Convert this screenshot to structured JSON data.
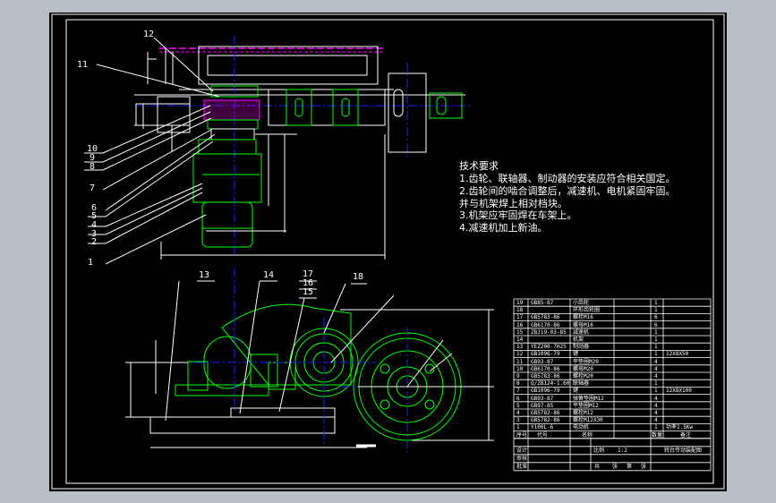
{
  "part_labels": [
    "12",
    "11",
    "10",
    "9",
    "8",
    "7",
    "6",
    "5",
    "4",
    "3",
    "2",
    "1",
    "13",
    "14",
    "17",
    "16",
    "15",
    "18"
  ],
  "tech_requirements": {
    "title": "技术要求",
    "lines": [
      "1.齿轮、联轴器、制动器的安装应符合相关国定。",
      "2.齿轮间的啮合调整后，减速机、电机紧固牢固。",
      "并与机架焊上相对档块。",
      "3.机架应牢固焊在车架上。",
      "4.减速机加上新油。"
    ]
  },
  "bom": {
    "rows": [
      {
        "no": "19",
        "code": "GB85-87",
        "name": "小齿轮",
        "qty": "1",
        "remark": ""
      },
      {
        "no": "18",
        "code": "",
        "name": "环形齿轮圈",
        "qty": "1",
        "remark": ""
      },
      {
        "no": "17",
        "code": "GB5783-86",
        "name": "螺栓M16",
        "qty": "6",
        "remark": ""
      },
      {
        "no": "16",
        "code": "GB6170-86",
        "name": "螺母M16",
        "qty": "6",
        "remark": ""
      },
      {
        "no": "15",
        "code": "ZBJ19-03-85",
        "name": "减速机",
        "qty": "1",
        "remark": ""
      },
      {
        "no": "14",
        "code": "",
        "name": "机架",
        "qty": "1",
        "remark": ""
      },
      {
        "no": "13",
        "code": "YEZ200-7H25",
        "name": "制动器",
        "qty": "1",
        "remark": ""
      },
      {
        "no": "12",
        "code": "GB1096-79",
        "name": "键",
        "qty": "1",
        "remark": "12X8X50"
      },
      {
        "no": "11",
        "code": "GB93-87",
        "name": "平垫圈M20",
        "qty": "4",
        "remark": ""
      },
      {
        "no": "10",
        "code": "GB6170-86",
        "name": "螺母M20",
        "qty": "4",
        "remark": ""
      },
      {
        "no": "9",
        "code": "GB5783-86",
        "name": "螺栓M20",
        "qty": "4",
        "remark": ""
      },
      {
        "no": "8",
        "code": "Q/ZB124-1.60",
        "name": "联轴器",
        "qty": "1",
        "remark": ""
      },
      {
        "no": "7",
        "code": "GB1096-79",
        "name": "键",
        "qty": "1",
        "remark": "12X8X100"
      },
      {
        "no": "6",
        "code": "GB93-87",
        "name": "弹簧垫圈M12",
        "qty": "4",
        "remark": ""
      },
      {
        "no": "5",
        "code": "GB97-85",
        "name": "平垫圈M12",
        "qty": "4",
        "remark": ""
      },
      {
        "no": "4",
        "code": "GB5782-86",
        "name": "螺栓M12",
        "qty": "4",
        "remark": ""
      },
      {
        "no": "3",
        "code": "GB5782-86",
        "name": "螺栓M12X30",
        "qty": "4",
        "remark": ""
      },
      {
        "no": "1",
        "code": "Y100L-6",
        "name": "电动机",
        "qty": "1",
        "remark": "功率1.5Kw"
      }
    ],
    "header": {
      "no": "序号",
      "code": "代号",
      "name": "名称",
      "qty": "数量",
      "remark": "备注"
    },
    "title_block": {
      "design": "设计",
      "check": "审核",
      "approve": "批准",
      "scale_label": "比例",
      "scale": "1:2",
      "drawing_name": "转台传动装配图",
      "sheet_a": "共",
      "sheet_b": "张",
      "sheet_c": "第",
      "sheet_d": "张"
    }
  },
  "colors": {
    "bg": "#000000",
    "frame": "#b9bfc6",
    "line": "#ffffff",
    "green": "#00ff00",
    "blue": "#2020ff",
    "magenta": "#ff00ff",
    "cyan": "#00ffff"
  }
}
